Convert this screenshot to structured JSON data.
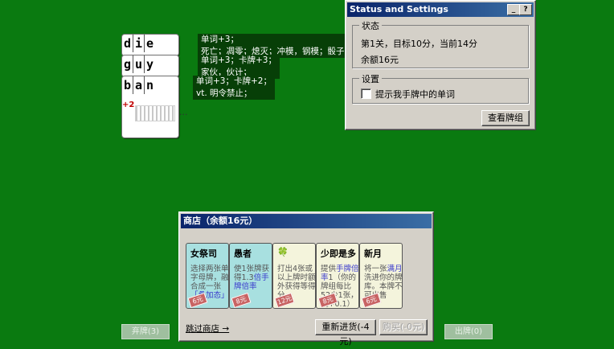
{
  "played_words": [
    {
      "letters": [
        "d",
        "i",
        "e"
      ],
      "tip_line1": "单词+3；",
      "tip_line2": "死亡；凋零；熄灭；冲模，钢模；骰子；"
    },
    {
      "letters": [
        "g",
        "u",
        "y"
      ],
      "tip_line1": "单词+3；卡牌+3；",
      "tip_line2": "家伙，伙计；"
    },
    {
      "letters": [
        "b",
        "a",
        "n"
      ],
      "tip_line1": "单词+3；卡牌+2；",
      "tip_line2": "vt. 明令禁止；",
      "bonus": "+2",
      "ellipsis": "..."
    }
  ],
  "status_window": {
    "title": "Status and Settings",
    "help_button": "?",
    "minimize_button": "_",
    "status_group_label": "状态",
    "status_line": "第1关，目标10分，当前14分",
    "balance_line": "余额16元",
    "settings_group_label": "设置",
    "checkbox_label": "提示我手牌中的单词",
    "checkbox_checked": false,
    "view_deck_button": "查看牌组"
  },
  "shop": {
    "title": "商店（余额16元）",
    "items": [
      {
        "name": "女祭司",
        "desc_pre": "选择两张单字母牌，融合成一张",
        "desc_hl": "「叠加态」",
        "desc_post": "",
        "price": "6元",
        "bg": "#a8e0e0"
      },
      {
        "name": "愚者",
        "desc_pre": "使1张牌获得1.3",
        "desc_hl": "倍手牌倍率",
        "desc_post": "",
        "price": "8元",
        "bg": "#a8e0e0"
      },
      {
        "name": "🍀",
        "desc_pre": "打出4张或以上牌时额外获得等得分",
        "desc_hl": "",
        "desc_post": "",
        "price": "12元",
        "bg": "#f4f4dc"
      },
      {
        "name": "少即是多",
        "desc_pre": "提供",
        "desc_hl": "手牌倍率",
        "desc_post": "1（你的牌组每比52少1张，就+0.1）",
        "price": "8元",
        "bg": "#f4f4dc"
      },
      {
        "name": "新月",
        "desc_pre": "将一张",
        "desc_hl": "满月",
        "desc_post": "洗进你的牌库。本牌不可出售",
        "price": "6元",
        "bg": "#f4f4dc"
      }
    ],
    "skip_link": "跳过商店 →",
    "reroll_button": "重新进货(-4元)",
    "buy_button": "购买(-0元)"
  },
  "bottom_buttons": {
    "discard": "弃牌(3)",
    "play": "出牌(0)"
  },
  "colors": {
    "felt": "#0a7a10",
    "window": "#d4d0c8",
    "titlebar": "#0a246a"
  }
}
